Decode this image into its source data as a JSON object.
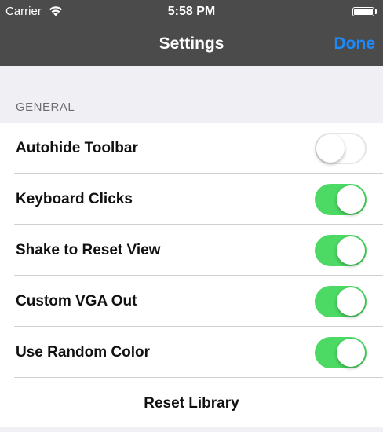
{
  "status_bar": {
    "carrier": "Carrier",
    "time": "5:58 PM",
    "wifi_icon": "wifi-icon",
    "battery_icon": "battery-icon"
  },
  "nav": {
    "title": "Settings",
    "done_label": "Done"
  },
  "section": {
    "header": "GENERAL"
  },
  "rows": [
    {
      "label": "Autohide Toolbar",
      "on": false
    },
    {
      "label": "Keyboard Clicks",
      "on": true
    },
    {
      "label": "Shake to Reset View",
      "on": true
    },
    {
      "label": "Custom VGA Out",
      "on": true
    },
    {
      "label": "Use Random Color",
      "on": true
    }
  ],
  "reset": {
    "label": "Reset Library"
  },
  "colors": {
    "bar": "#4b4b4b",
    "accent": "#1a8cff",
    "toggle_on": "#4cd964",
    "background": "#efeff4"
  }
}
